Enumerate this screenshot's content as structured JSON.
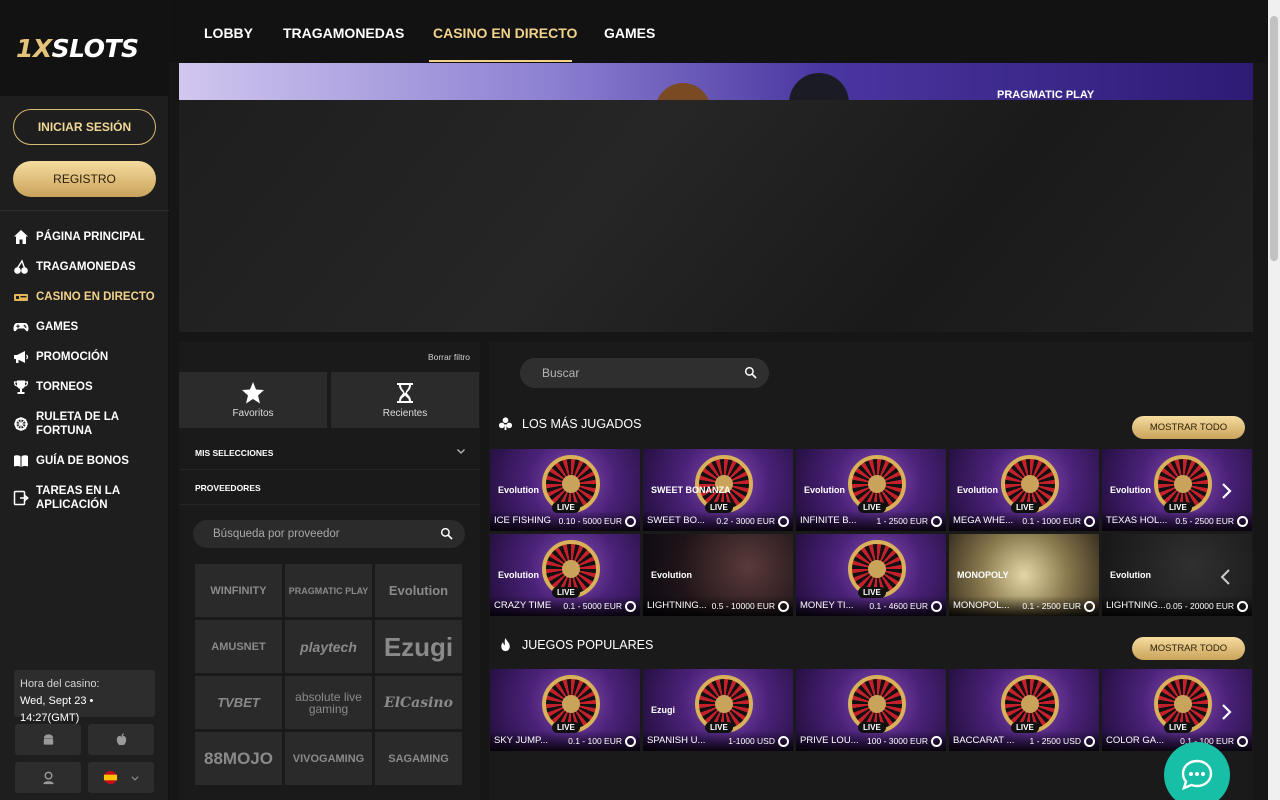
{
  "brand": {
    "logo_main": "1X",
    "logo_sub": "SLOTS"
  },
  "auth": {
    "login_label": "INICIAR SESIÓN",
    "register_label": "REGISTRO"
  },
  "sidebar": {
    "items": [
      {
        "label": "PÁGINA PRINCIPAL",
        "icon": "home-icon"
      },
      {
        "label": "TRAGAMONEDAS",
        "icon": "cherries-icon"
      },
      {
        "label": "CASINO EN DIRECTO",
        "icon": "live-casino-icon"
      },
      {
        "label": "GAMES",
        "icon": "gamepad-icon"
      },
      {
        "label": "PROMOCIÓN",
        "icon": "megaphone-icon"
      },
      {
        "label": "TORNEOS",
        "icon": "trophy-icon"
      },
      {
        "label": "RULETA DE LA FORTUNA",
        "icon": "wheel-icon"
      },
      {
        "label": "GUÍA DE BONOS",
        "icon": "book-icon"
      },
      {
        "label": "TAREAS EN LA APLICACIÓN",
        "icon": "app-task-icon"
      }
    ],
    "active_index": 2
  },
  "casino_time": {
    "label": "Hora del casino:",
    "value": "Wed, Sept 23 • 14:27(GMT)"
  },
  "topnav": {
    "tabs": [
      "LOBBY",
      "TRAGAMONEDAS",
      "CASINO EN DIRECTO",
      "GAMES"
    ],
    "active_index": 2
  },
  "banner": {
    "provider": "PRAGMATIC PLAY"
  },
  "filter": {
    "clear_label": "Borrar filtro",
    "favorites_label": "Favoritos",
    "recent_label": "Recientes",
    "my_selections_label": "MIS SELECCIONES",
    "providers_label": "PROVEEDORES",
    "provider_search_placeholder": "Búsqueda por proveedor",
    "providers": [
      "WINFINITY",
      "PRAGMATIC PLAY",
      "Evolution",
      "AMUSNET",
      "playtech",
      "Ezugi",
      "TVBET",
      "absolute live gaming",
      "ElCasino",
      "88MOJO",
      "VIVOGAMING",
      "SAGAMING"
    ]
  },
  "search": {
    "placeholder": "Buscar"
  },
  "sections": [
    {
      "title": "LOS MÁS JUGADOS",
      "show_all": "MOSTRAR TODO",
      "rows": [
        [
          {
            "name": "ICE FISHING",
            "range": "0.10 - 5000 EUR",
            "brand": "Evolution",
            "live": "LIVE"
          },
          {
            "name": "SWEET BO...",
            "range": "0.2 - 3000 EUR",
            "brand": "SWEET BONANZA",
            "live": "LIVE"
          },
          {
            "name": "INFINITE B...",
            "range": "1 - 2500 EUR",
            "brand": "Evolution",
            "live": "LIVE"
          },
          {
            "name": "MEGA WHE...",
            "range": "0.1 - 1000 EUR",
            "brand": "Evolution",
            "live": "LIVE"
          },
          {
            "name": "TEXAS HOL...",
            "range": "0.5 - 2500 EUR",
            "brand": "Evolution",
            "live": "LIVE"
          }
        ],
        [
          {
            "name": "CRAZY TIME",
            "range": "0.1 - 5000 EUR",
            "brand": "Evolution",
            "live": "LIVE"
          },
          {
            "name": "LIGHTNING...",
            "range": "0.5 - 10000 EUR",
            "brand": "Evolution",
            "live": ""
          },
          {
            "name": "MONEY TI...",
            "range": "0.1 - 4600 EUR",
            "brand": "",
            "live": "LIVE"
          },
          {
            "name": "MONOPOL...",
            "range": "0.1 - 2500 EUR",
            "brand": "MONOPOLY",
            "live": ""
          },
          {
            "name": "LIGHTNING...",
            "range": "0.05 - 20000 EUR",
            "brand": "Evolution",
            "live": ""
          }
        ]
      ]
    },
    {
      "title": "JUEGOS POPULARES",
      "show_all": "MOSTRAR TODO",
      "rows": [
        [
          {
            "name": "SKY JUMP...",
            "range": "0.1 - 100 EUR",
            "brand": "",
            "live": "LIVE"
          },
          {
            "name": "SPANISH U...",
            "range": "1-1000 USD",
            "brand": "Ezugi",
            "live": "LIVE"
          },
          {
            "name": "PRIVE LOU...",
            "range": "100 - 3000 EUR",
            "brand": "",
            "live": "LIVE"
          },
          {
            "name": "BACCARAT ...",
            "range": "1 - 2500 USD",
            "brand": "",
            "live": "LIVE"
          },
          {
            "name": "COLOR GA...",
            "range": "0.1 - 100 EUR",
            "brand": "",
            "live": "LIVE"
          }
        ]
      ]
    }
  ]
}
